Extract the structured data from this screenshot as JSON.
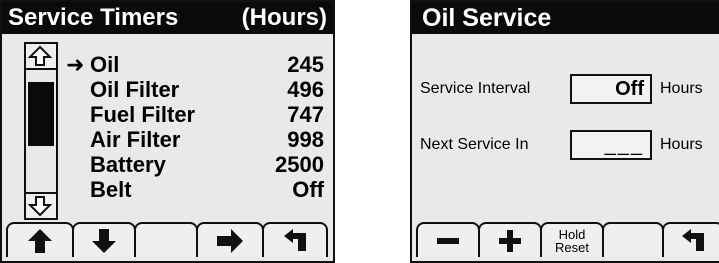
{
  "service_timers": {
    "title": "Service Timers",
    "unit": "(Hours)",
    "items": [
      {
        "name": "Oil",
        "value": "245",
        "selected": true
      },
      {
        "name": "Oil Filter",
        "value": "496"
      },
      {
        "name": "Fuel Filter",
        "value": "747"
      },
      {
        "name": "Air Filter",
        "value": "998"
      },
      {
        "name": "Battery",
        "value": "2500"
      },
      {
        "name": "Belt",
        "value": "Off"
      }
    ],
    "softkeys": [
      "arrow-up-icon",
      "arrow-down-icon",
      "blank",
      "arrow-right-icon",
      "back-icon"
    ]
  },
  "oil_service": {
    "title": "Oil Service",
    "service_interval": {
      "label": "Service Interval",
      "value": "Off",
      "unit": "Hours"
    },
    "next_service": {
      "label": "Next Service In",
      "value": "___",
      "unit": "Hours"
    },
    "softkeys": {
      "minus": "minus-icon",
      "plus": "plus-icon",
      "hold_reset": "Hold\nReset",
      "back": "back-icon"
    }
  }
}
